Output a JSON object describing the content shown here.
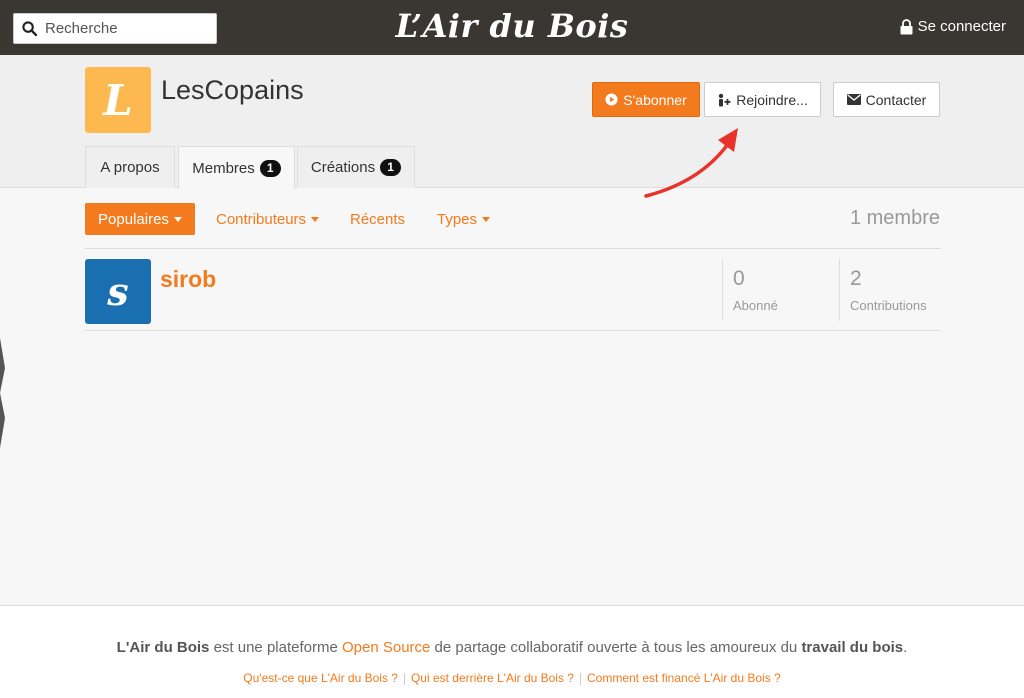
{
  "topbar": {
    "search_placeholder": "Recherche",
    "brand": "L’Air du Bois",
    "login_label": "Se connecter"
  },
  "group": {
    "avatar_letter": "L",
    "title": "LesCopains",
    "subscribe_label": "S'abonner",
    "join_label": "Rejoindre...",
    "contact_label": "Contacter"
  },
  "tabs": [
    {
      "label": "A propos"
    },
    {
      "label": "Membres",
      "badge": "1"
    },
    {
      "label": "Créations",
      "badge": "1"
    }
  ],
  "filters": {
    "popular": "Populaires",
    "contributors": "Contributeurs",
    "recent": "Récents",
    "types": "Types",
    "count": "1 membre"
  },
  "members": [
    {
      "avatar_letter": "s",
      "name": "sirob",
      "followers_value": "0",
      "followers_label": "Abonné",
      "contributions_value": "2",
      "contributions_label": "Contributions"
    }
  ],
  "footer": {
    "brand": "L'Air du Bois",
    "text_1": " est une plateforme ",
    "open_source": "Open Source",
    "text_2": " de partage collaboratif ouverte à tous les amoureux du ",
    "woodwork": "travail du bois",
    "text_3": ".",
    "links": [
      "Qu'est-ce que L'Air du Bois ?",
      "Qui est derrière L'Air du Bois ?",
      "Comment est financé L'Air du Bois ?"
    ]
  },
  "colors": {
    "accent": "#f37b1d",
    "topbar": "#3a3631",
    "group_avatar": "#fdb94f",
    "member_avatar": "#1a6fb0",
    "annotation_arrow": "#e8322a"
  },
  "icons": {
    "search": "search-icon",
    "login": "lock-icon",
    "subscribe": "play-circle-icon",
    "join": "user-plus-icon",
    "contact": "envelope-icon"
  }
}
